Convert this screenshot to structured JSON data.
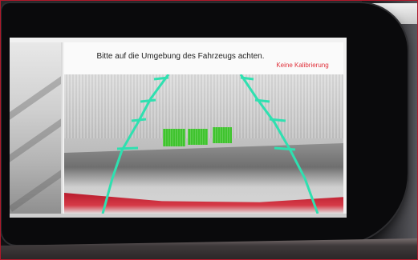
{
  "screen": {
    "notice": "Bitte auf die Umgebung des Fahrzeugs achten.",
    "calibration_status": "Keine Kalibrierung"
  },
  "colors": {
    "guide_lines": "#2fe0b0",
    "calibration_text": "#e0303a",
    "blocks": "#39c427",
    "frame": "#b0182a"
  },
  "overlay": {
    "distance_blocks": 3,
    "tick_marks_per_side": 4
  }
}
